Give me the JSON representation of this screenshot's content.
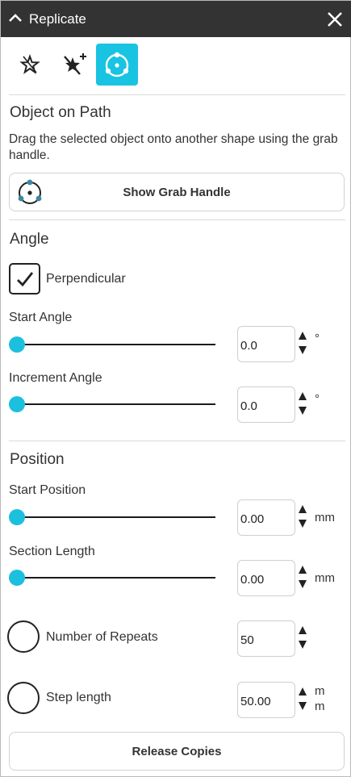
{
  "window": {
    "title": "Replicate"
  },
  "toolbar": {
    "tools": [
      "star-outline-icon",
      "wand-sparkle-icon",
      "object-on-path-icon"
    ],
    "active_color": "#19c3e2"
  },
  "object_on_path": {
    "title": "Object on Path",
    "description": "Drag the selected object onto another shape using the grab handle.",
    "grab_button_label": "Show Grab Handle"
  },
  "angle": {
    "title": "Angle",
    "perpendicular_label": "Perpendicular",
    "perpendicular_checked": true,
    "start_angle": {
      "label": "Start Angle",
      "value": "0.0",
      "unit": "°"
    },
    "increment_angle": {
      "label": "Increment Angle",
      "value": "0.0",
      "unit": "°"
    }
  },
  "position": {
    "title": "Position",
    "start_position": {
      "label": "Start Position",
      "value": "0.00",
      "unit": "mm"
    },
    "section_length": {
      "label": "Section Length",
      "value": "0.00",
      "unit": "mm"
    },
    "number_of_repeats": {
      "label": "Number of Repeats",
      "value": "50"
    },
    "step_length": {
      "label": "Step length",
      "value": "50.00",
      "unit_line1": "m",
      "unit_line2": "m"
    }
  },
  "release_button_label": "Release Copies",
  "colors": {
    "accent": "#1cc0de",
    "titlebar": "#333333"
  }
}
